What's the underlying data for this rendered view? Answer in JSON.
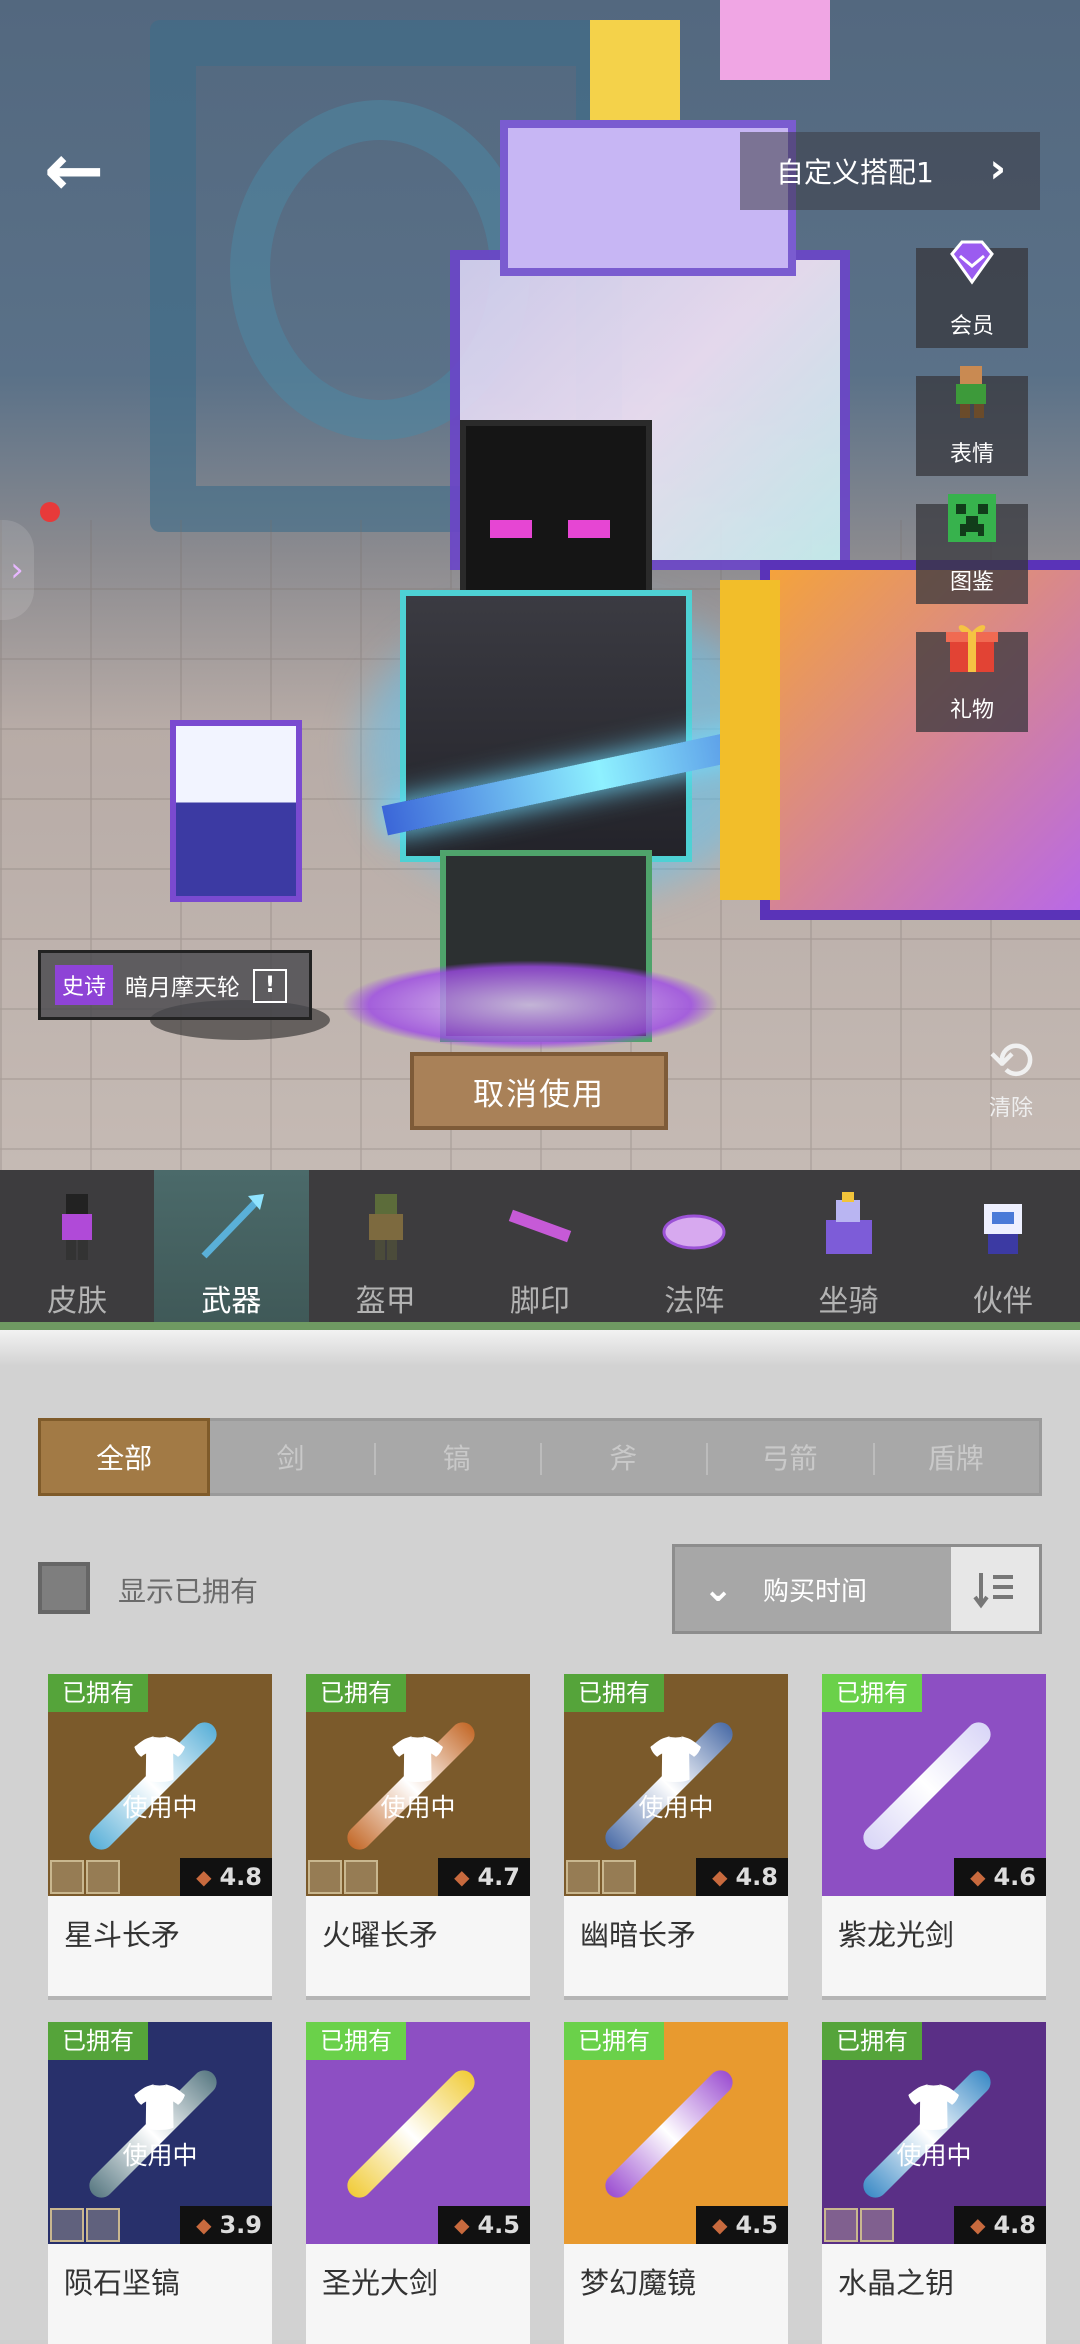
{
  "top_bar": {
    "back_icon": "arrow-left-icon",
    "outfit_label": "自定义搭配1",
    "outfit_chevron": "›"
  },
  "side_menu": [
    {
      "id": "vip",
      "label": "会员",
      "icon": "diamond-icon",
      "color": "#8a4fe0"
    },
    {
      "id": "emote",
      "label": "表情",
      "icon": "character-emote-icon",
      "color": "#3d9a3a"
    },
    {
      "id": "codex",
      "label": "图鉴",
      "icon": "creeper-icon",
      "color": "#37b24d"
    },
    {
      "id": "gift",
      "label": "礼物",
      "icon": "gift-icon",
      "color": "#e24334"
    }
  ],
  "selected_item": {
    "rarity": "史诗",
    "name": "暗月摩天轮",
    "info_icon": "!"
  },
  "unequip_label": "取消使用",
  "clear_label": "清除",
  "categories": [
    {
      "label": "皮肤",
      "active": false
    },
    {
      "label": "武器",
      "active": true
    },
    {
      "label": "盔甲",
      "active": false
    },
    {
      "label": "脚印",
      "active": false
    },
    {
      "label": "法阵",
      "active": false
    },
    {
      "label": "坐骑",
      "active": false
    },
    {
      "label": "伙伴",
      "active": false
    }
  ],
  "subtabs": [
    "全部",
    "剑",
    "镐",
    "斧",
    "弓箭",
    "盾牌"
  ],
  "active_subtab": "全部",
  "filter": {
    "show_owned_label": "显示已拥有",
    "sort_label": "购买时间"
  },
  "items": [
    {
      "name": "星斗长矛",
      "owned_label": "已拥有",
      "in_use": true,
      "in_use_label": "使用中",
      "rating": "4.8",
      "bg": "#7b5a2b",
      "weapon": "#5ab0d8"
    },
    {
      "name": "火曜长矛",
      "owned_label": "已拥有",
      "in_use": true,
      "in_use_label": "使用中",
      "rating": "4.7",
      "bg": "#7b5a2b",
      "weapon": "#c46a2a"
    },
    {
      "name": "幽暗长矛",
      "owned_label": "已拥有",
      "in_use": true,
      "in_use_label": "使用中",
      "rating": "4.8",
      "bg": "#7b5a2b",
      "weapon": "#4d6ea8"
    },
    {
      "name": "紫龙光剑",
      "owned_label": "已拥有",
      "in_use": false,
      "in_use_label": "",
      "rating": "4.6",
      "bg": "#8d4fc3",
      "weapon": "#d9d6f7"
    },
    {
      "name": "陨石坚镐",
      "owned_label": "已拥有",
      "in_use": true,
      "in_use_label": "使用中",
      "rating": "3.9",
      "bg": "#28306b",
      "weapon": "#5a7a84"
    },
    {
      "name": "圣光大剑",
      "owned_label": "已拥有",
      "in_use": false,
      "in_use_label": "",
      "rating": "4.5",
      "bg": "#8d4fc3",
      "weapon": "#f1cc3a"
    },
    {
      "name": "梦幻魔镜",
      "owned_label": "已拥有",
      "in_use": false,
      "in_use_label": "",
      "rating": "4.5",
      "bg": "#e89a2f",
      "weapon": "#9c4fd1"
    },
    {
      "name": "水晶之钥",
      "owned_label": "已拥有",
      "in_use": true,
      "in_use_label": "使用中",
      "rating": "4.8",
      "bg": "#5a2f86",
      "weapon": "#3e8cc7"
    }
  ]
}
